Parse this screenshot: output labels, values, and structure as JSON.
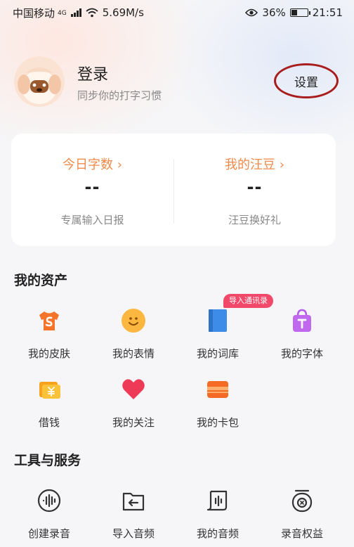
{
  "status_bar": {
    "carrier": "中国移动",
    "network": "4G",
    "speed": "5.69M/s",
    "battery": "36%",
    "time": "21:51"
  },
  "profile": {
    "title": "登录",
    "subtitle": "同步你的打字习惯",
    "settings_label": "设置"
  },
  "stats": {
    "left": {
      "title": "今日字数 ›",
      "value": "--",
      "sub": "专属输入日报"
    },
    "right": {
      "title": "我的汪豆 ›",
      "value": "--",
      "sub": "汪豆换好礼"
    }
  },
  "assets": {
    "title": "我的资产",
    "badge": "导入通讯录",
    "items": [
      {
        "label": "我的皮肤",
        "icon": "tshirt-icon"
      },
      {
        "label": "我的表情",
        "icon": "smiley-icon"
      },
      {
        "label": "我的词库",
        "icon": "book-icon"
      },
      {
        "label": "我的字体",
        "icon": "shopping-bag-icon"
      },
      {
        "label": "借钱",
        "icon": "yuan-card-icon"
      },
      {
        "label": "我的关注",
        "icon": "heart-icon"
      },
      {
        "label": "我的卡包",
        "icon": "wallet-icon"
      }
    ]
  },
  "tools": {
    "title": "工具与服务",
    "items": [
      {
        "label": "创建录音",
        "icon": "waveform-icon"
      },
      {
        "label": "导入音频",
        "icon": "import-folder-icon"
      },
      {
        "label": "我的音频",
        "icon": "audio-file-icon"
      },
      {
        "label": "录音权益",
        "icon": "recorder-icon"
      }
    ]
  },
  "colors": {
    "accent_orange": "#f08a4b",
    "badge_pink": "#f2496b",
    "annotation_red": "#a81d1d"
  }
}
